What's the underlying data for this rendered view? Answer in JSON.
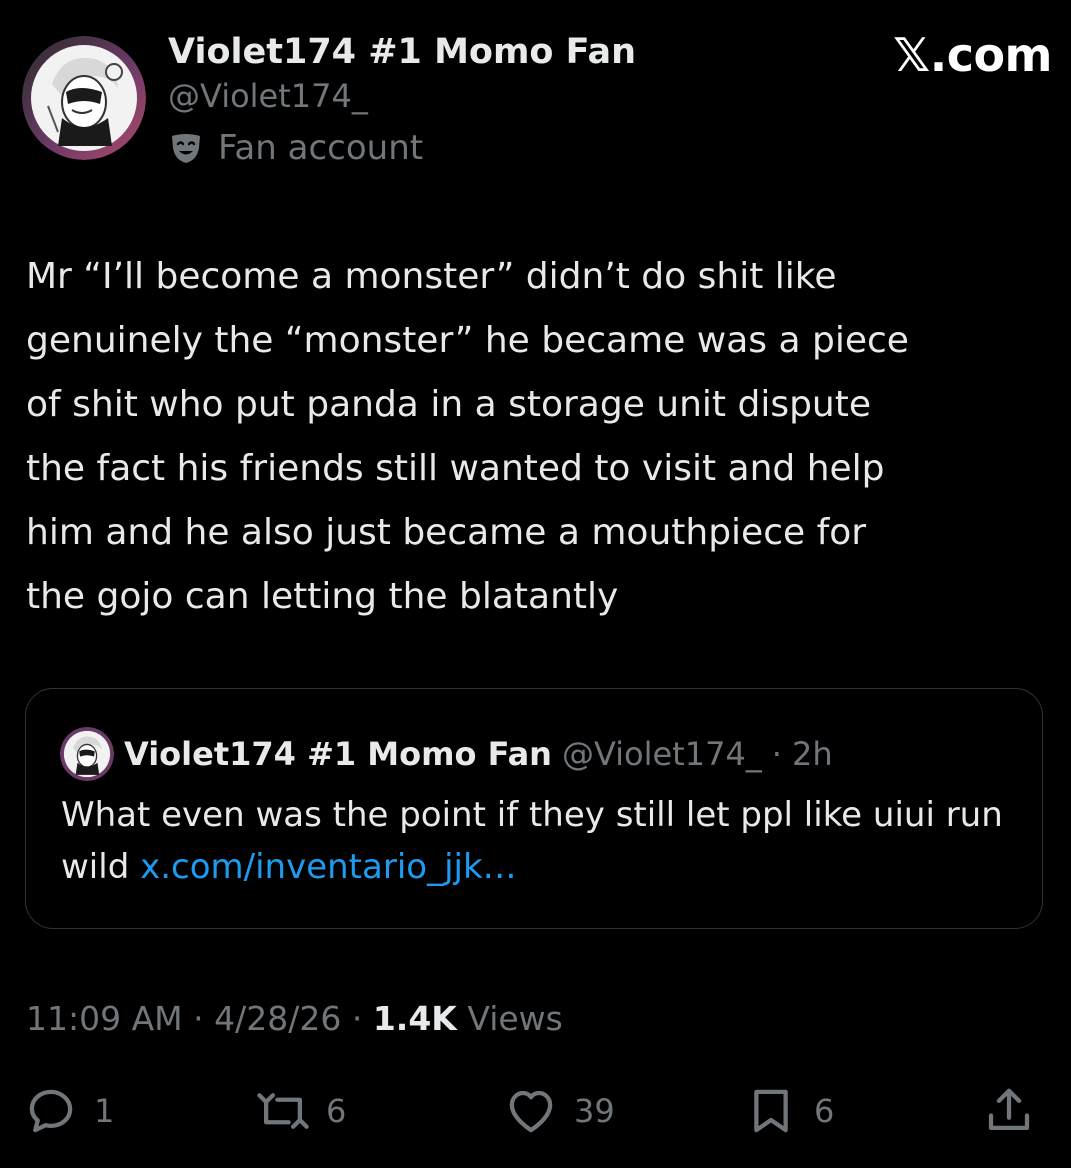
{
  "author": {
    "display_name": "Violet174 #1 Momo Fan",
    "handle": "@Violet174_",
    "label": "Fan account",
    "label_icon": "drama-mask-icon"
  },
  "site_brand": "𝕏.com",
  "tweet": {
    "text": "Mr “I’ll become a monster” didn’t do shit like\ngenuinely the “monster” he became was a piece\nof shit who put panda in a storage unit dispute\nthe fact his friends still wanted to visit and help\nhim and he also just became a mouthpiece for\nthe gojo can letting the blatantly"
  },
  "quoted_tweet": {
    "display_name": "Violet174 #1 Momo Fan",
    "handle": "@Violet174_",
    "separator": "·",
    "time": "2h",
    "text": "What even was the point if they still let ppl like uiui run wild ",
    "link_text": "x.com/inventario_jjk…"
  },
  "meta": {
    "time": "11:09 AM",
    "sep1": " · ",
    "date": "4/28/26",
    "sep2": " · ",
    "views_count": "1.4K",
    "views_label": " Views"
  },
  "actions": {
    "reply_count": "1",
    "repost_count": "6",
    "like_count": "39",
    "bookmark_count": "6"
  },
  "colors": {
    "background": "#000000",
    "text_primary": "#e7e9ea",
    "text_secondary": "#71767b",
    "link": "#1d9bf0",
    "border": "#2f3336",
    "avatar_ring": "#8e3f7a"
  }
}
